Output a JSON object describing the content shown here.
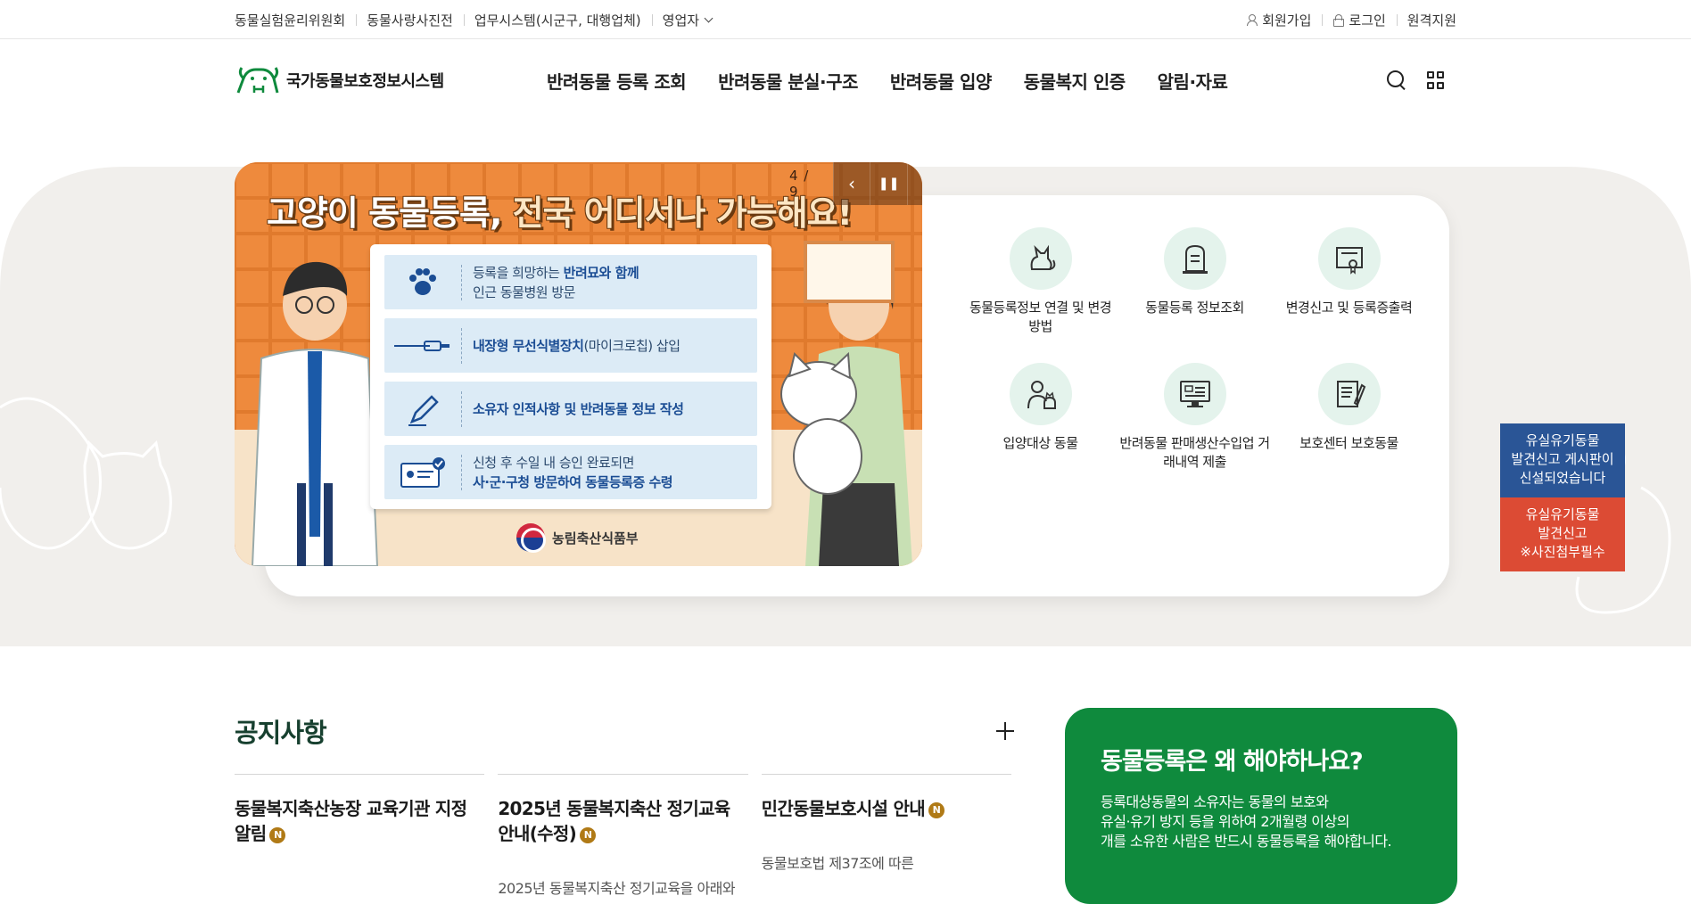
{
  "util_left": [
    "동물실험윤리위원회",
    "동물사랑사진전",
    "업무시스템(시군구, 대행업체)",
    "영업자"
  ],
  "util_right": {
    "signup": "회원가입",
    "login": "로그인",
    "remote": "원격지원"
  },
  "logo": {
    "text": "국가동물보호정보시스템"
  },
  "gnb": [
    "반려동물 등록 조회",
    "반려동물 분실·구조",
    "반려동물 입양",
    "동물복지 인증",
    "알림·자료"
  ],
  "banner": {
    "title_a": "고양이 동물등록,",
    "title_b": " 전국 어디서나 가능해요!",
    "counter": "4 / 9",
    "steps": [
      {
        "line1": "등록을 희망하는 ",
        "bold1": "반려묘와 함께",
        "line2": "인근 동물병원 방문"
      },
      {
        "line1": "",
        "bold1": "내장형 무선식별장치",
        "line2": "(마이크로칩) 삽입"
      },
      {
        "line1": "",
        "bold1": "소유자 인적사항 및 반려동물 정보 작성",
        "line2": ""
      },
      {
        "line1": "신청 후 수일 내 승인 완료되면",
        "bold1": "",
        "line2": "사·군·구청 방문하여 동물등록증 수령"
      }
    ],
    "ministry": "농림축산식품부"
  },
  "quick": [
    {
      "label": "동물등록정보 연결 및 변경방법",
      "icon": "cat-icon"
    },
    {
      "label": "동물등록 정보조회",
      "icon": "tombstone-icon"
    },
    {
      "label": "변경신고 및 등록증출력",
      "icon": "certificate-icon"
    },
    {
      "label": "입양대상 동물",
      "icon": "person-pet-icon"
    },
    {
      "label": "반려동물 판매생산수입업 거래내역 제출",
      "icon": "monitor-icon"
    },
    {
      "label": "보호센터 보호동물",
      "icon": "document-pen-icon"
    }
  ],
  "float": {
    "blue": [
      "유실유기동물",
      "발견신고 게시판이",
      "신설되었습니다"
    ],
    "red": [
      "유실유기동물",
      "발견신고",
      "※사진첨부필수"
    ]
  },
  "notice": {
    "title": "공지사항",
    "items": [
      {
        "title": "동물복지축산농장 교육기관 지정 알림",
        "desc": ""
      },
      {
        "title": "2025년 동물복지축산 정기교육 안내(수정)",
        "desc": "2025년 동물복지축산 정기교육을 아래와"
      },
      {
        "title": "민간동물보호시설 안내",
        "desc": "동물보호법 제37조에 따른"
      }
    ],
    "badge": "N"
  },
  "why": {
    "title": "동물등록은 왜 해야하나요?",
    "desc": [
      "등록대상동물의 소유자는 동물의 보호와",
      "유실·유기 방지 등을 위하여 2개월령 이상의",
      "개를 소유한 사람은 반드시 동물등록을 해야합니다."
    ]
  },
  "colors": {
    "brand_green": "#0f8a3d",
    "banner_orange": "#ee8a3d",
    "alert_blue": "#2a5596",
    "alert_red": "#dc4b34"
  }
}
